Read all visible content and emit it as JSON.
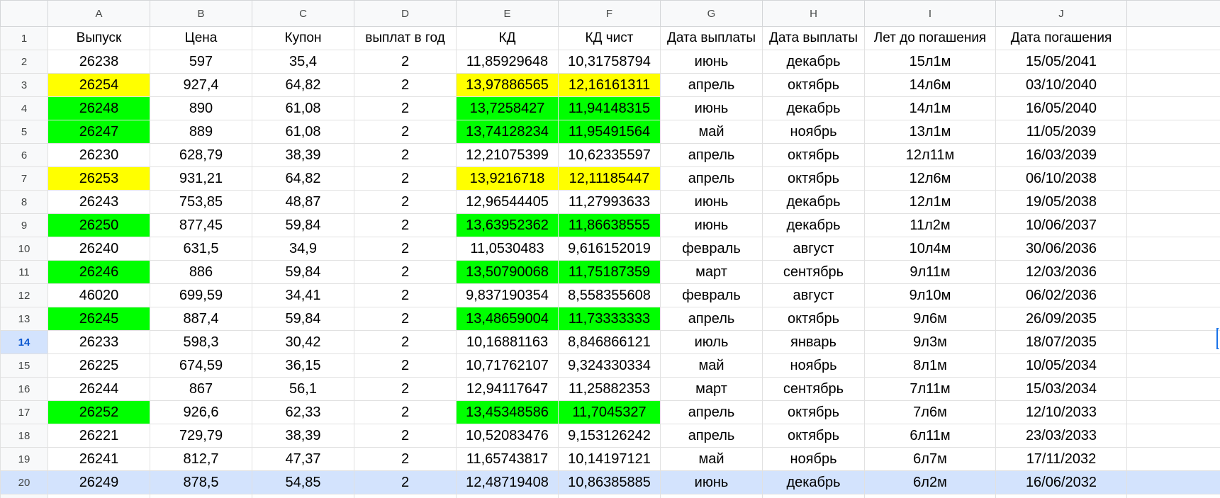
{
  "columns": [
    "A",
    "B",
    "C",
    "D",
    "E",
    "F",
    "G",
    "H",
    "I",
    "J"
  ],
  "header": {
    "row_number": "1",
    "cells": [
      "Выпуск",
      "Цена",
      "Купон",
      "выплат в год",
      "КД",
      "КД чист",
      "Дата выплаты",
      "Дата выплаты",
      "Лет до погашения",
      "Дата погашения"
    ]
  },
  "rows": [
    {
      "n": "2",
      "cells": [
        "26238",
        "597",
        "35,4",
        "2",
        "11,85929648",
        "10,31758794",
        "июнь",
        "декабрь",
        "15л1м",
        "15/05/2041"
      ],
      "hl": "none"
    },
    {
      "n": "3",
      "cells": [
        "26254",
        "927,4",
        "64,82",
        "2",
        "13,97886565",
        "12,16161311",
        "апрель",
        "октябрь",
        "14л6м",
        "03/10/2040"
      ],
      "hl": "yellow"
    },
    {
      "n": "4",
      "cells": [
        "26248",
        "890",
        "61,08",
        "2",
        "13,7258427",
        "11,94148315",
        "июнь",
        "декабрь",
        "14л1м",
        "16/05/2040"
      ],
      "hl": "green"
    },
    {
      "n": "5",
      "cells": [
        "26247",
        "889",
        "61,08",
        "2",
        "13,74128234",
        "11,95491564",
        "май",
        "ноябрь",
        "13л1м",
        "11/05/2039"
      ],
      "hl": "green"
    },
    {
      "n": "6",
      "cells": [
        "26230",
        "628,79",
        "38,39",
        "2",
        "12,21075399",
        "10,62335597",
        "апрель",
        "октябрь",
        "12л11м",
        "16/03/2039"
      ],
      "hl": "none"
    },
    {
      "n": "7",
      "cells": [
        "26253",
        "931,21",
        "64,82",
        "2",
        "13,9216718",
        "12,11185447",
        "апрель",
        "октябрь",
        "12л6м",
        "06/10/2038"
      ],
      "hl": "yellow"
    },
    {
      "n": "8",
      "cells": [
        "26243",
        "753,85",
        "48,87",
        "2",
        "12,96544405",
        "11,27993633",
        "июнь",
        "декабрь",
        "12л1м",
        "19/05/2038"
      ],
      "hl": "none"
    },
    {
      "n": "9",
      "cells": [
        "26250",
        "877,45",
        "59,84",
        "2",
        "13,63952362",
        "11,86638555",
        "июнь",
        "декабрь",
        "11л2м",
        "10/06/2037"
      ],
      "hl": "green"
    },
    {
      "n": "10",
      "cells": [
        "26240",
        "631,5",
        "34,9",
        "2",
        "11,0530483",
        "9,616152019",
        "февраль",
        "август",
        "10л4м",
        "30/06/2036"
      ],
      "hl": "none"
    },
    {
      "n": "11",
      "cells": [
        "26246",
        "886",
        "59,84",
        "2",
        "13,50790068",
        "11,75187359",
        "март",
        "сентябрь",
        "9л11м",
        "12/03/2036"
      ],
      "hl": "green"
    },
    {
      "n": "12",
      "cells": [
        "46020",
        "699,59",
        "34,41",
        "2",
        "9,837190354",
        "8,558355608",
        "февраль",
        "август",
        "9л10м",
        "06/02/2036"
      ],
      "hl": "none"
    },
    {
      "n": "13",
      "cells": [
        "26245",
        "887,4",
        "59,84",
        "2",
        "13,48659004",
        "11,73333333",
        "апрель",
        "октябрь",
        "9л6м",
        "26/09/2035"
      ],
      "hl": "green"
    },
    {
      "n": "14",
      "cells": [
        "26233",
        "598,3",
        "30,42",
        "2",
        "10,16881163",
        "8,846866121",
        "июль",
        "январь",
        "9л3м",
        "18/07/2035"
      ],
      "hl": "none"
    },
    {
      "n": "15",
      "cells": [
        "26225",
        "674,59",
        "36,15",
        "2",
        "10,71762107",
        "9,324330334",
        "май",
        "ноябрь",
        "8л1м",
        "10/05/2034"
      ],
      "hl": "none"
    },
    {
      "n": "16",
      "cells": [
        "26244",
        "867",
        "56,1",
        "2",
        "12,94117647",
        "11,25882353",
        "март",
        "сентябрь",
        "7л11м",
        "15/03/2034"
      ],
      "hl": "none"
    },
    {
      "n": "17",
      "cells": [
        "26252",
        "926,6",
        "62,33",
        "2",
        "13,45348586",
        "11,7045327",
        "апрель",
        "октябрь",
        "7л6м",
        "12/10/2033"
      ],
      "hl": "green"
    },
    {
      "n": "18",
      "cells": [
        "26221",
        "729,79",
        "38,39",
        "2",
        "10,52083476",
        "9,153126242",
        "апрель",
        "октябрь",
        "6л11м",
        "23/03/2033"
      ],
      "hl": "none"
    },
    {
      "n": "19",
      "cells": [
        "26241",
        "812,7",
        "47,37",
        "2",
        "11,65743817",
        "10,14197121",
        "май",
        "ноябрь",
        "6л7м",
        "17/11/2032"
      ],
      "hl": "none"
    },
    {
      "n": "20",
      "cells": [
        "26249",
        "878,5",
        "54,85",
        "2",
        "12,48719408",
        "10,86385885",
        "июнь",
        "декабрь",
        "6л2м",
        "16/06/2032"
      ],
      "hl": "none"
    }
  ],
  "selected_row": "14",
  "highlighted_row": "20",
  "highlight_columns": [
    0,
    4,
    5
  ],
  "colors": {
    "green": "#00ff00",
    "yellow": "#ffff00",
    "selection": "#d3e3fd",
    "accent": "#1a73e8"
  }
}
